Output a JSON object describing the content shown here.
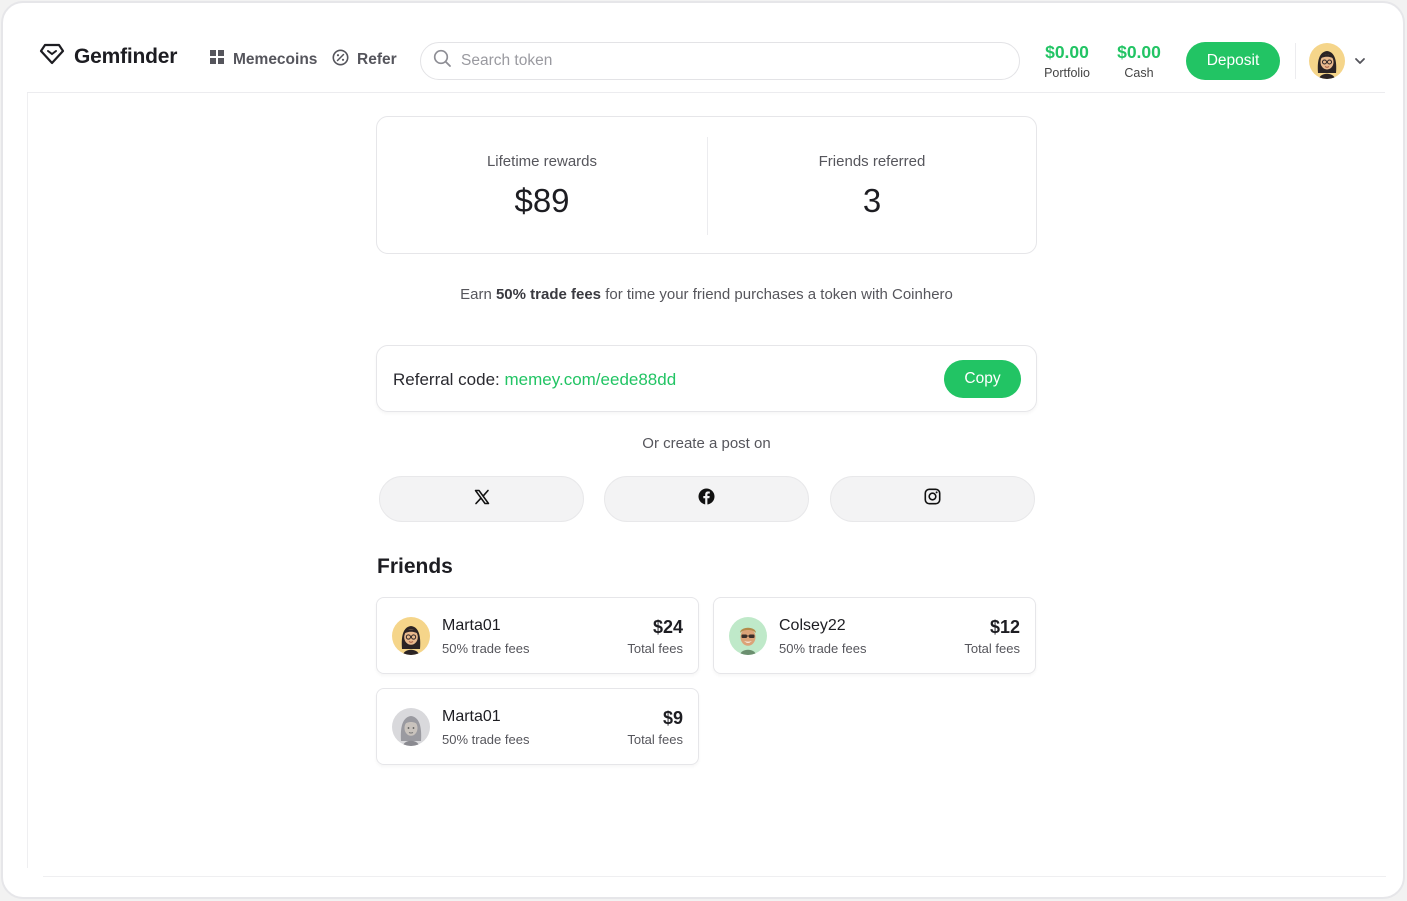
{
  "header": {
    "brand": "Gemfinder",
    "nav": [
      {
        "label": "Memecoins",
        "icon": "grid-icon"
      },
      {
        "label": "Refer",
        "icon": "percent-badge-icon"
      }
    ],
    "search_placeholder": "Search token",
    "portfolio": {
      "value": "$0.00",
      "label": "Portfolio"
    },
    "cash": {
      "value": "$0.00",
      "label": "Cash"
    },
    "deposit_label": "Deposit"
  },
  "stats": {
    "lifetime_label": "Lifetime rewards",
    "lifetime_value": "$89",
    "friends_label": "Friends referred",
    "friends_value": "3"
  },
  "earn": {
    "prefix": "Earn ",
    "highlight": "50% trade fees",
    "suffix": " for time your friend purchases a token with Coinhero"
  },
  "referral": {
    "label": "Referral code: ",
    "code": "memey.com/eede88dd",
    "copy_label": "Copy"
  },
  "share": {
    "prompt": "Or create a post on",
    "networks": [
      "x-logo-icon",
      "facebook-icon",
      "instagram-icon"
    ]
  },
  "friends": {
    "title": "Friends",
    "items": [
      {
        "name": "Marta01",
        "sub": "50% trade fees",
        "amount": "$24",
        "amount_label": "Total fees"
      },
      {
        "name": "Colsey22",
        "sub": "50% trade fees",
        "amount": "$12",
        "amount_label": "Total fees"
      },
      {
        "name": "Marta01",
        "sub": "50% trade fees",
        "amount": "$9",
        "amount_label": "Total fees"
      }
    ]
  },
  "colors": {
    "accent": "#22c464",
    "avatar_yellow": "#f5d58a",
    "avatar_green": "#bfe9c9",
    "avatar_grey": "#d9d9dc"
  }
}
